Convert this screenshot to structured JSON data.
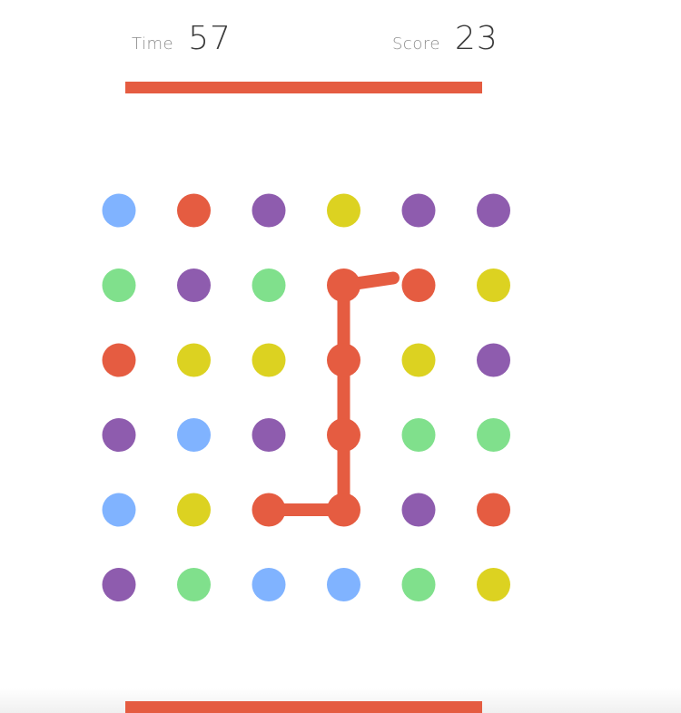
{
  "hud": {
    "time_label": "Time",
    "time_value": "57",
    "score_label": "Score",
    "score_value": "23"
  },
  "colors": {
    "red": "#e55c41",
    "purple": "#8e5cae",
    "yellow": "#dcd221",
    "blue": "#80b3ff",
    "green": "#80e08c",
    "timer_bar": "#e55c41"
  },
  "board": {
    "rows": 6,
    "cols": 6,
    "dots": [
      [
        "blue",
        "red",
        "purple",
        "yellow",
        "purple",
        "purple"
      ],
      [
        "green",
        "purple",
        "green",
        "red",
        "red",
        "yellow"
      ],
      [
        "red",
        "yellow",
        "yellow",
        "red",
        "yellow",
        "purple"
      ],
      [
        "purple",
        "blue",
        "purple",
        "red",
        "green",
        "green"
      ],
      [
        "blue",
        "yellow",
        "red",
        "red",
        "purple",
        "red"
      ],
      [
        "purple",
        "green",
        "blue",
        "blue",
        "green",
        "yellow"
      ]
    ],
    "connection": {
      "color": "red",
      "path": [
        [
          4,
          2
        ],
        [
          4,
          3
        ],
        [
          3,
          3
        ],
        [
          2,
          3
        ],
        [
          1,
          3
        ]
      ],
      "drag_toward": [
        1,
        4
      ]
    }
  }
}
